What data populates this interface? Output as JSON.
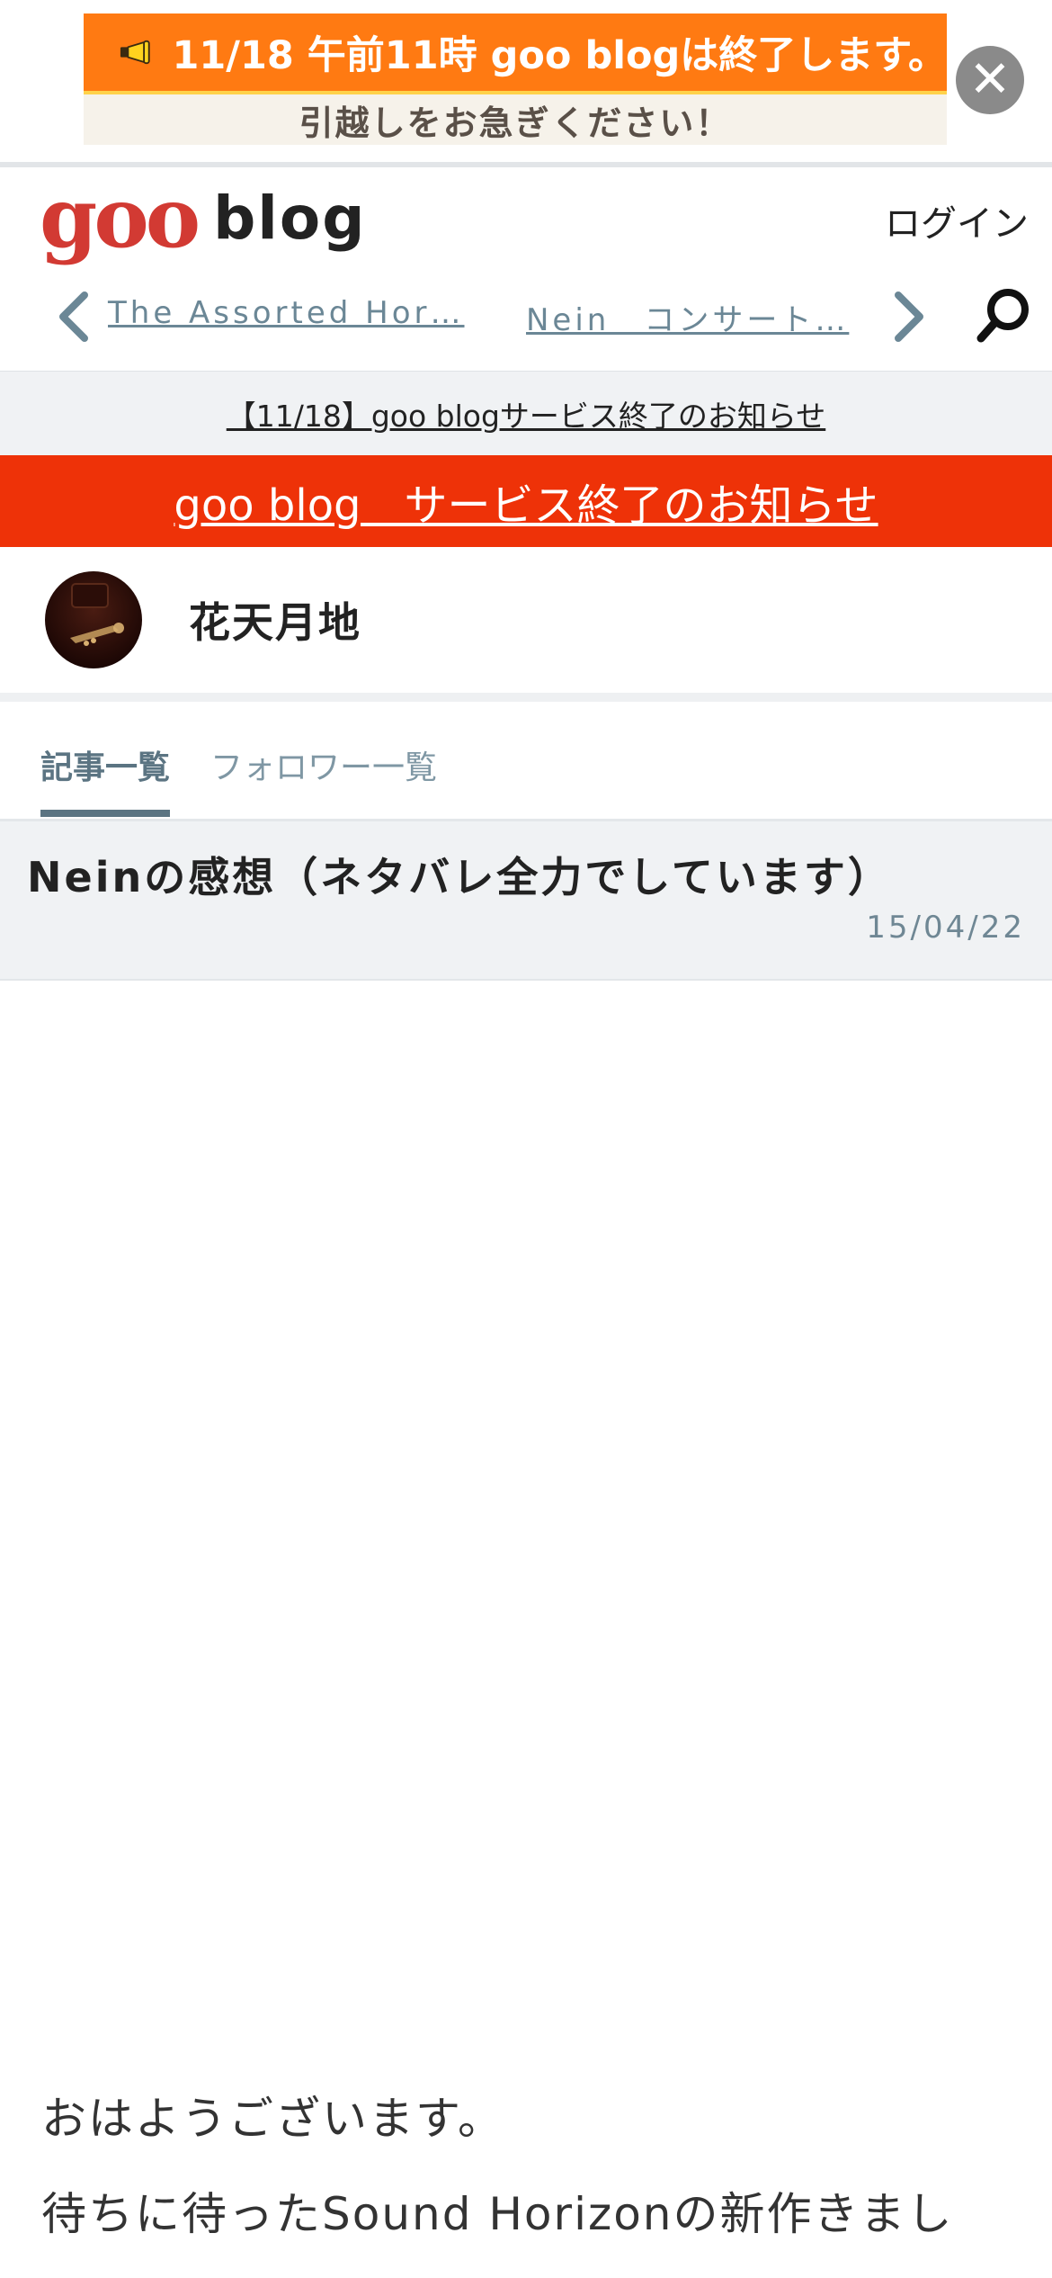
{
  "promo": {
    "headline": "11/18 午前11時 goo blogは終了します。",
    "subline": "引越しをお急ぎください！",
    "close_symbol": "✕",
    "megaphone_icon": "megaphone-icon",
    "colors": {
      "orange": "#ff7a12",
      "cream": "#f6f2ea",
      "close_bg": "#8a8a8a"
    }
  },
  "header": {
    "logo_goo": "goo",
    "logo_blog": "blog",
    "login_label": "ログイン",
    "nav_links": [
      {
        "label": "The Assorted Hor…"
      },
      {
        "label": "Nein　コンサート…"
      }
    ],
    "icons": [
      "chevron-left-icon",
      "chevron-right-icon",
      "search-icon"
    ]
  },
  "notice": {
    "gray_link": "【11/18】goo blogサービス終了のお知らせ",
    "red_link": "goo blog　サービス終了のお知らせ",
    "colors": {
      "red": "#ee3208",
      "gray_bg": "#f0f2f4"
    }
  },
  "profile": {
    "blog_name": "花天月地"
  },
  "tabs": {
    "items": [
      {
        "label": "記事一覧",
        "active": true
      },
      {
        "label": "フォロワー一覧",
        "active": false
      }
    ]
  },
  "article": {
    "title": "Neinの感想（ネタバレ全力でしています）",
    "date": "15/04/22",
    "paragraphs": [
      "おはようございます。",
      "待ちに待ったSound Horizonの新作きまし"
    ]
  }
}
